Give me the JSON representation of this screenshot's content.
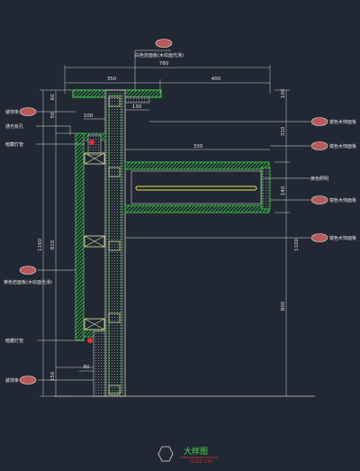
{
  "drawing": {
    "title": "大样图",
    "scale": "SCALE 1:10",
    "dimensions": {
      "top_total": "780",
      "top_left": "350",
      "top_right": "400",
      "cap_130": "130",
      "cap_100": "100",
      "box_330": "330",
      "left_1160": "1160",
      "left_810": "810",
      "left_150": "150",
      "right_1100": "1100",
      "right_800": "800",
      "right_310": "310",
      "right_140": "140",
      "bottom_80": "80",
      "top_small_a": "60",
      "top_small_b": "50",
      "top_right_small": "100"
    },
    "labels": {
      "top_center": "白色岩面板(木纹面光滑)",
      "left_1": "装饰条",
      "left_2": "通光有孔",
      "left_3": "暗藏灯管",
      "left_4": "黄色岩面板(木纹面光滑)",
      "left_5": "暗藏灯管",
      "left_6": "装饰条",
      "right_1": "镜色木饰面板",
      "right_2": "镜色木饰面板",
      "right_3": "黄色照明",
      "right_4": "镜色木饰面板",
      "right_5": "镜色木饰面板"
    }
  }
}
